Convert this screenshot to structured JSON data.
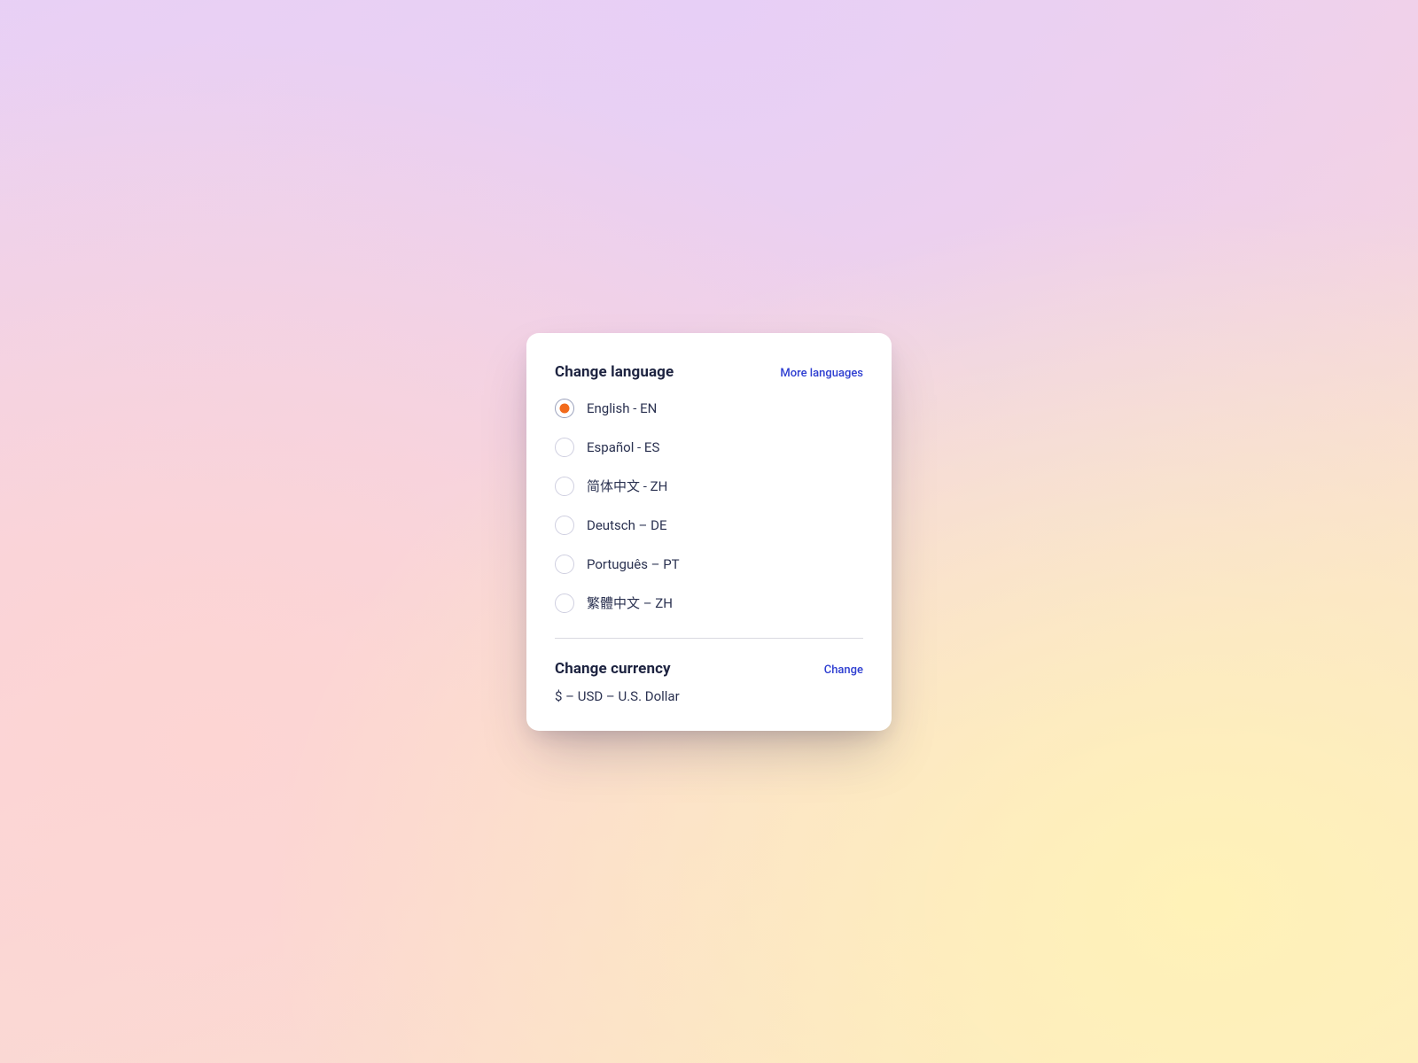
{
  "language": {
    "title": "Change language",
    "more_link": "More languages",
    "options": [
      {
        "label": "English - EN",
        "selected": true
      },
      {
        "label": "Español - ES",
        "selected": false
      },
      {
        "label": "简体中文 - ZH",
        "selected": false
      },
      {
        "label": "Deutsch – DE",
        "selected": false
      },
      {
        "label": "Português – PT",
        "selected": false
      },
      {
        "label": "繁體中文 – ZH",
        "selected": false
      }
    ]
  },
  "currency": {
    "title": "Change currency",
    "change_link": "Change",
    "value": "$ – USD – U.S. Dollar"
  },
  "colors": {
    "accent": "#f26a1b",
    "link": "#2f3fd1",
    "text": "#1d2340"
  }
}
